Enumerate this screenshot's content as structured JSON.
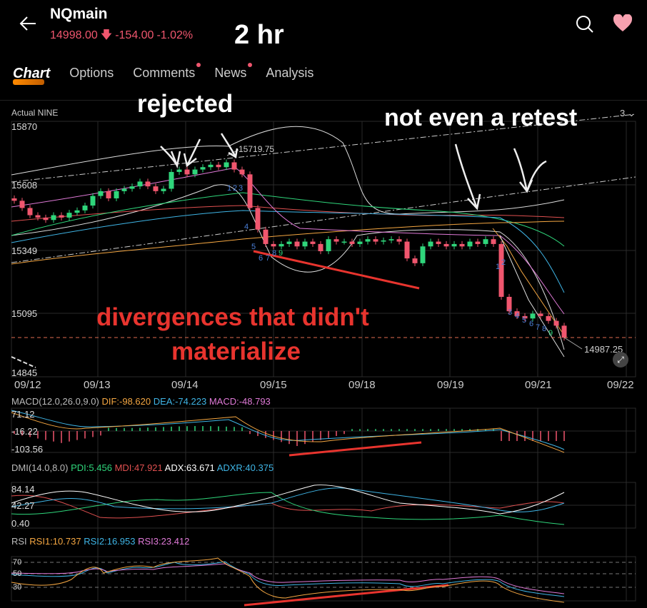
{
  "header": {
    "title": "NQmain",
    "price": "14998.00",
    "change": "-154.00",
    "change_pct": "-1.02%",
    "direction_icon": "arrow-down-icon",
    "interval_annotation": "2 hr"
  },
  "tabs": [
    {
      "label": "Chart",
      "active": true
    },
    {
      "label": "Options"
    },
    {
      "label": "Comments",
      "badge": true
    },
    {
      "label": "News",
      "badge": true
    },
    {
      "label": "Analysis"
    }
  ],
  "colors": {
    "down": "#f0566e",
    "up": "#2fd67b",
    "dif": "#f5a742",
    "dea": "#3fb5e6",
    "macd": "#e07ad8",
    "annotation_red": "#e8342e"
  },
  "annotations": {
    "rejected": "rejected",
    "no_retest": "not even a retest",
    "divergence_1": "divergences that didn't",
    "divergence_2": "materialize"
  },
  "main_chart": {
    "indicator_label": "Actual NINE",
    "layout_selector": "3",
    "y_ticks": [
      "15870",
      "15608",
      "15349",
      "15095",
      "14845"
    ],
    "x_ticks": [
      "09/12",
      "09/13",
      "09/14",
      "09/15",
      "09/18",
      "09/19",
      "09/21",
      "09/22"
    ],
    "high_label": "15719.75",
    "last_label": "14987.25",
    "nine_counts_1": [
      "1",
      "2",
      "3",
      "4",
      "5",
      "6",
      "7",
      "8",
      "9"
    ],
    "nine_counts_2": [
      "1",
      "2",
      "3",
      "4",
      "5",
      "6",
      "7",
      "8",
      "9"
    ]
  },
  "chart_data": {
    "type": "candlestick",
    "closes": [
      15560,
      15530,
      15500,
      15490,
      15480,
      15500,
      15490,
      15510,
      15520,
      15540,
      15580,
      15600,
      15570,
      15600,
      15610,
      15620,
      15640,
      15620,
      15600,
      15610,
      15680,
      15690,
      15670,
      15690,
      15700,
      15710,
      15700,
      15720,
      15690,
      15670,
      15530,
      15440,
      15380,
      15370,
      15380,
      15390,
      15370,
      15390,
      15380,
      15350,
      15400,
      15390,
      15390,
      15380,
      15390,
      15400,
      15390,
      15395,
      15400,
      15390,
      15320,
      15300,
      15370,
      15390,
      15380,
      15370,
      15380,
      15370,
      15390,
      15380,
      15400,
      15380,
      15160,
      15100,
      15080,
      15070,
      15090,
      15080,
      15060,
      15040,
      14990
    ],
    "ylim": [
      14845,
      15870
    ]
  },
  "macd": {
    "label": "MACD(12.0,26.0,9.0)",
    "dif": "DIF:-98.620",
    "dea": "DEA:-74.223",
    "macd": "MACD:-48.793",
    "y_ticks": [
      "71.12",
      "-16.22",
      "-103.56"
    ]
  },
  "dmi": {
    "label": "DMI(14.0,8.0)",
    "pdi": "PDI:5.456",
    "mdi": "MDI:47.921",
    "adx": "ADX:63.671",
    "adxr": "ADXR:40.375",
    "y_ticks": [
      "84.14",
      "42.27",
      "0.40"
    ]
  },
  "rsi": {
    "label": "RSI",
    "rsi1": "RSI1:10.737",
    "rsi2": "RSI2:16.953",
    "rsi3": "RSI3:23.412",
    "y_ticks": [
      "70",
      "50",
      "30"
    ]
  }
}
